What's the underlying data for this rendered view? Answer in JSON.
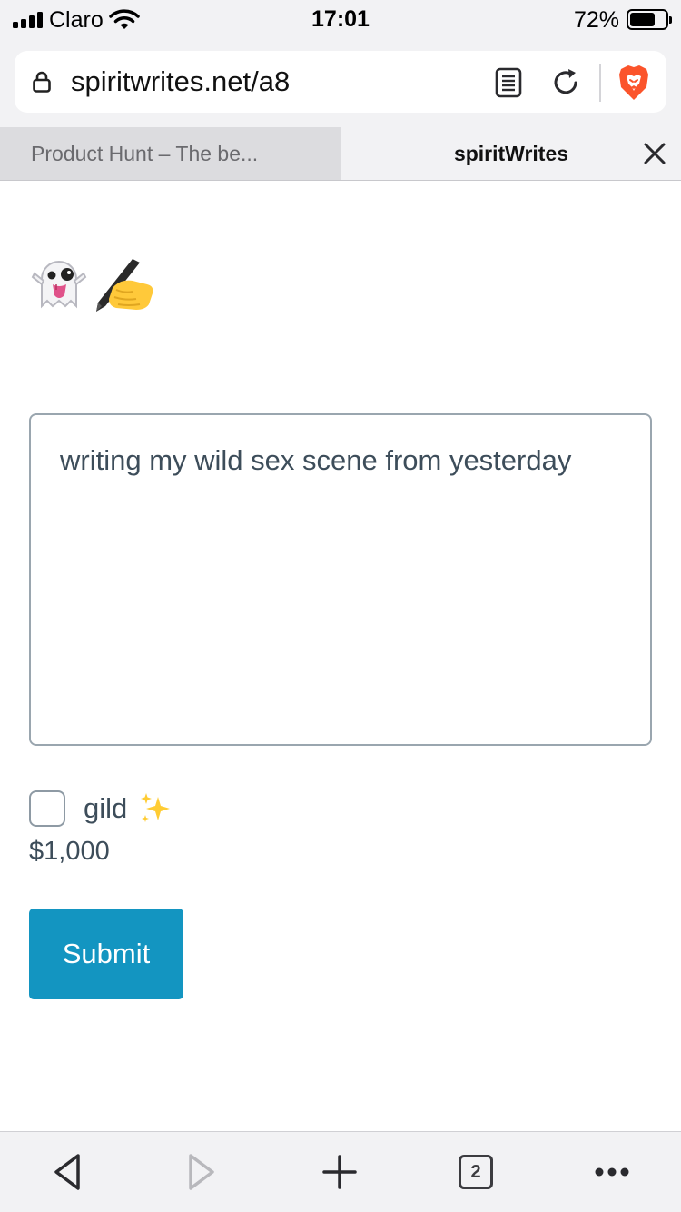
{
  "status_bar": {
    "carrier": "Claro",
    "time": "17:01",
    "battery_percent": "72%",
    "battery_level": 0.72
  },
  "browser": {
    "url": "spiritwrites.net/a8",
    "icons": [
      "lock-icon",
      "reader-mode-icon",
      "reload-icon",
      "brave-shields-icon"
    ]
  },
  "tabs": [
    {
      "label": "Product Hunt – The be...",
      "active": false
    },
    {
      "label": "spiritWrites",
      "active": true
    }
  ],
  "page": {
    "title_emojis": [
      "ghost-tongue-emoji",
      "writing-hand-emoji"
    ],
    "textarea_value": "writing my wild sex scene from yesterday",
    "gild_label": "gild",
    "gild_icon": "sparkles-icon",
    "gild_checked": false,
    "price": "$1,000",
    "submit_label": "Submit",
    "submit_color": "#1395c1"
  },
  "toolbar": {
    "tab_count": "2",
    "icons": [
      "back-icon",
      "forward-icon",
      "new-tab-icon",
      "tabs-icon",
      "more-icon"
    ]
  }
}
